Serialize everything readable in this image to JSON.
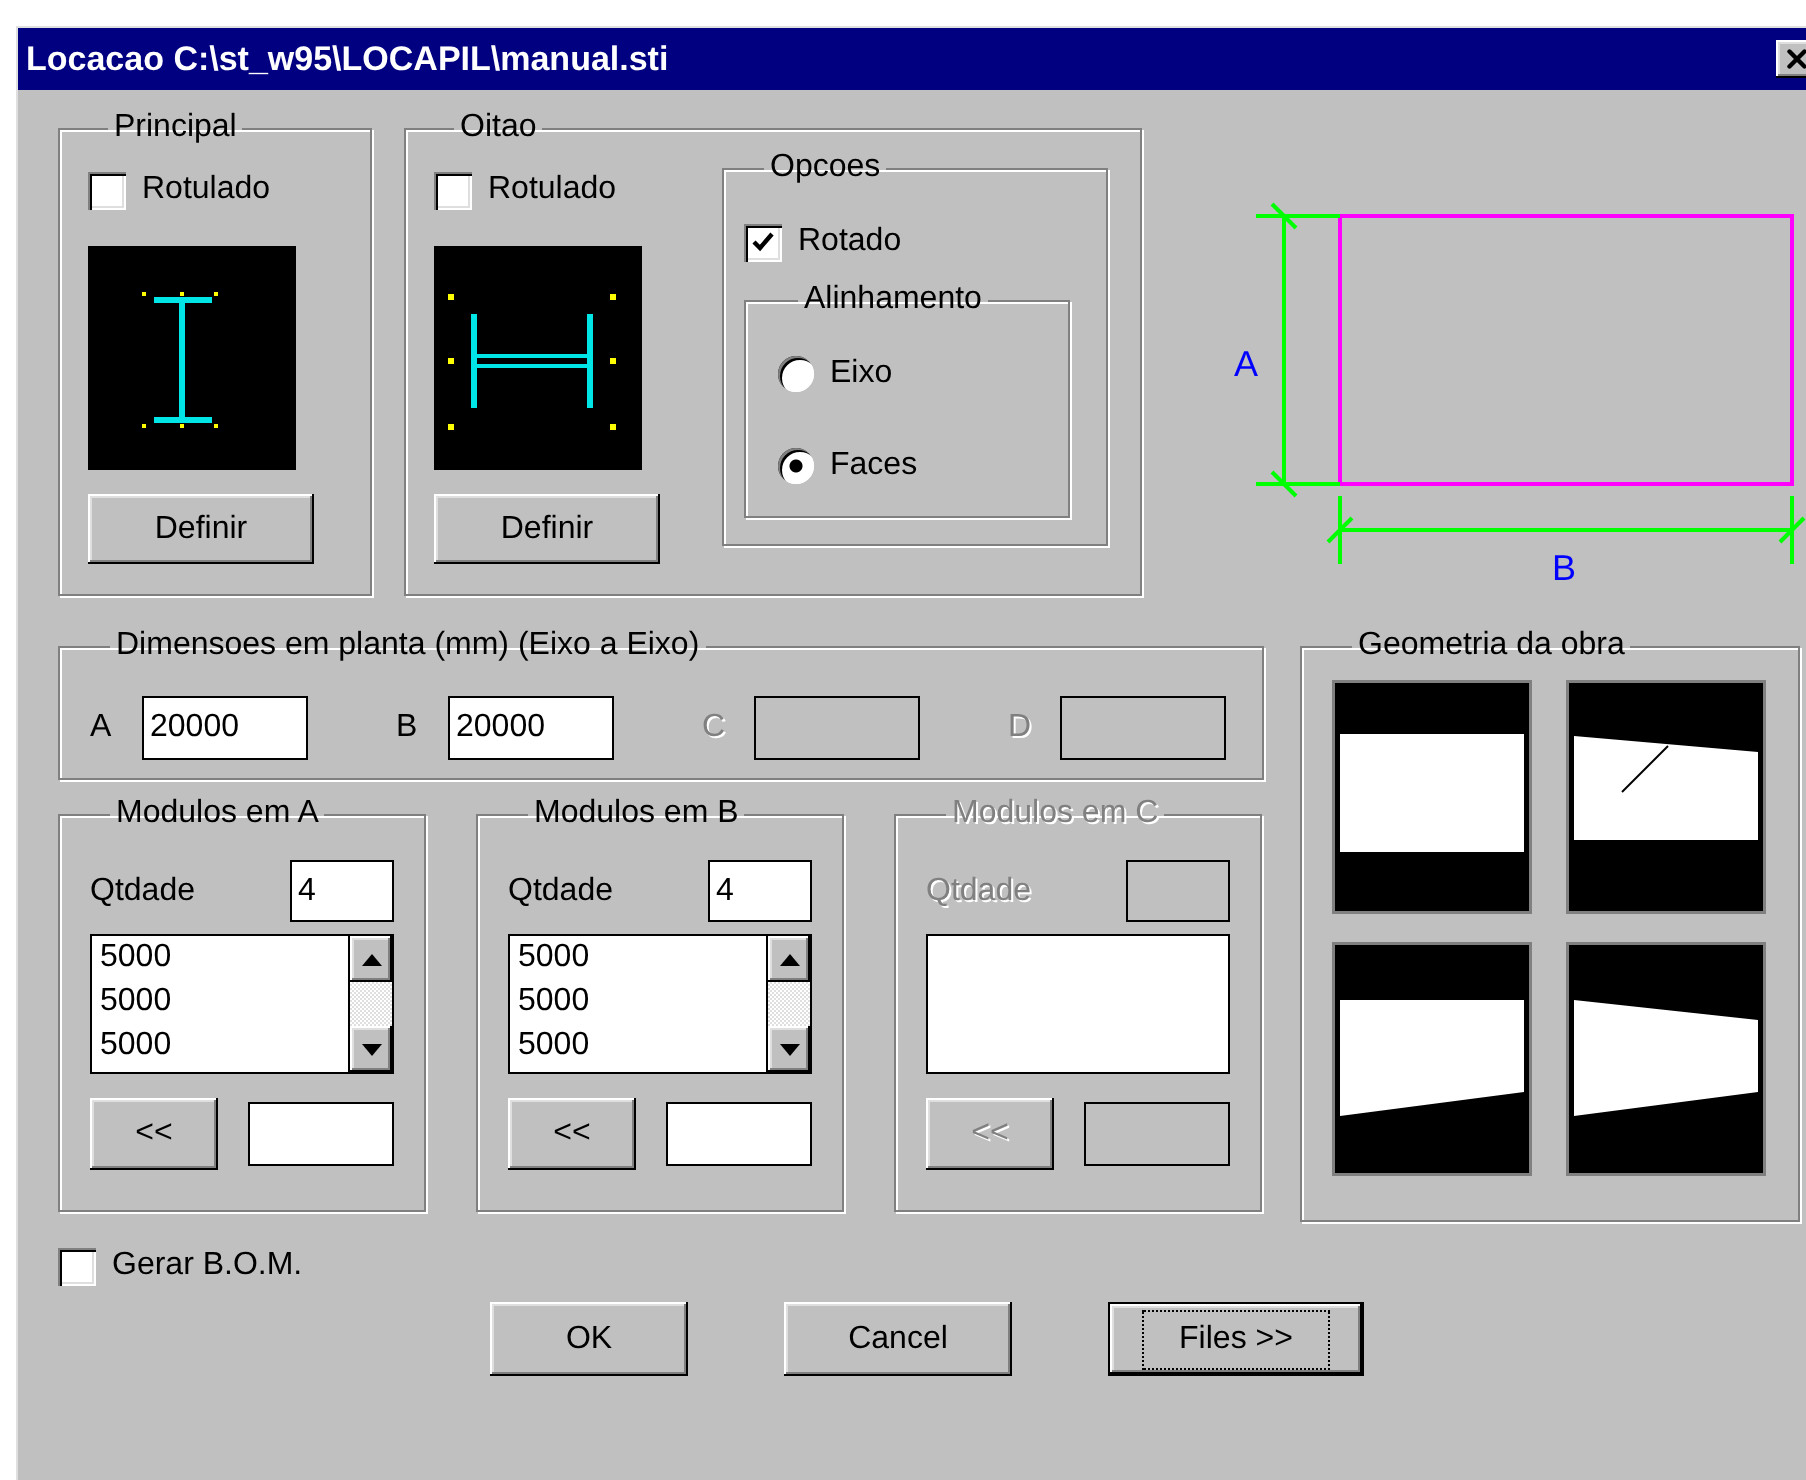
{
  "window": {
    "title": "Locacao C:\\st_w95\\LOCAPIL\\manual.sti"
  },
  "principal": {
    "title": "Principal",
    "rotulado": {
      "label": "Rotulado",
      "checked": false
    },
    "button": "Definir"
  },
  "oitao": {
    "title": "Oitao",
    "rotulado": {
      "label": "Rotulado",
      "checked": false
    },
    "button": "Definir",
    "opcoes": {
      "title": "Opcoes",
      "rotado": {
        "label": "Rotado",
        "checked": true
      },
      "alinhamento": {
        "title": "Alinhamento",
        "options": [
          {
            "label": "Eixo",
            "selected": false
          },
          {
            "label": "Faces",
            "selected": true
          }
        ]
      }
    }
  },
  "diagram": {
    "label_a": "A",
    "label_b": "B"
  },
  "dimensoes": {
    "title": "Dimensoes em planta (mm) (Eixo a Eixo)",
    "fields": [
      {
        "label": "A",
        "value": "20000",
        "disabled": false
      },
      {
        "label": "B",
        "value": "20000",
        "disabled": false
      },
      {
        "label": "C",
        "disabled": true
      },
      {
        "label": "D",
        "disabled": true
      }
    ]
  },
  "modulos": [
    {
      "title": "Modulos em A",
      "qtdade_label": "Qtdade",
      "qtdade": "4",
      "values": [
        "5000",
        "5000",
        "5000"
      ],
      "button": "<<",
      "disabled": false
    },
    {
      "title": "Modulos em B",
      "qtdade_label": "Qtdade",
      "qtdade": "4",
      "values": [
        "5000",
        "5000",
        "5000"
      ],
      "button": "<<",
      "disabled": false
    },
    {
      "title": "Modulos em C",
      "qtdade_label": "Qtdade",
      "button": "<<",
      "disabled": true
    }
  ],
  "geometria": {
    "title": "Geometria da obra"
  },
  "bom": {
    "label": "Gerar B.O.M.",
    "checked": false
  },
  "buttons": [
    {
      "label": "OK",
      "focused": false
    },
    {
      "label": "Cancel",
      "focused": false
    },
    {
      "label": "Files >>",
      "focused": true
    }
  ]
}
